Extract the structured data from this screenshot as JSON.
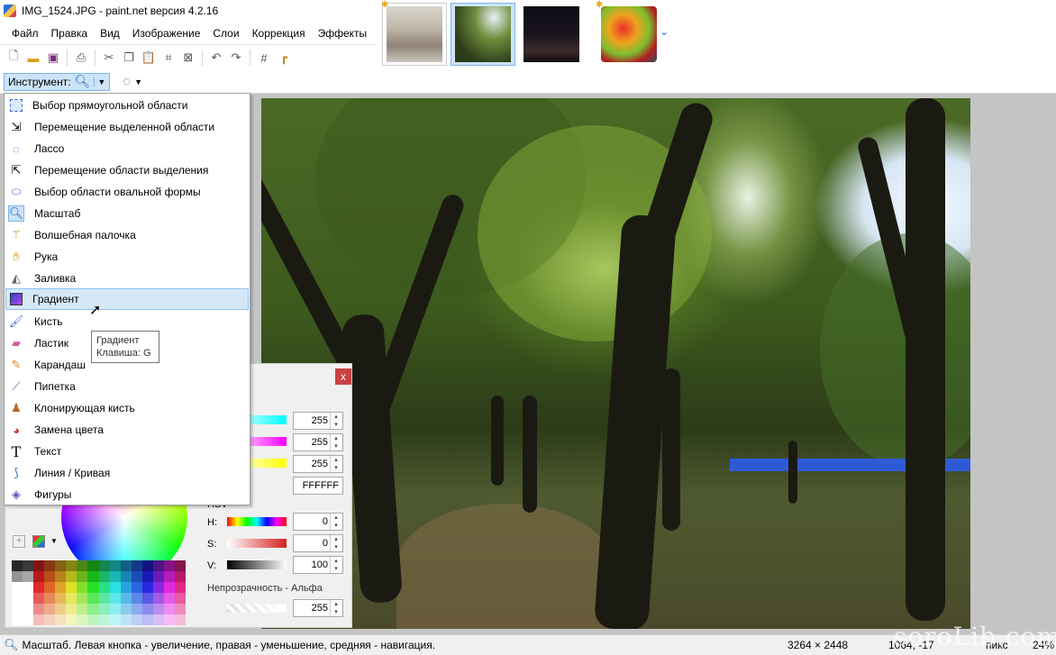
{
  "window": {
    "title": "IMG_1524.JPG - paint.net версия 4.2.16"
  },
  "menu": [
    "Файл",
    "Правка",
    "Вид",
    "Изображение",
    "Слои",
    "Коррекция",
    "Эффекты"
  ],
  "tool_options": {
    "tool_label": "Инструмент:"
  },
  "tool_menu": {
    "items": [
      {
        "label": "Выбор прямоугольной области",
        "icon": "rectangle-select-icon"
      },
      {
        "label": "Перемещение выделенной области",
        "icon": "move-selected-icon"
      },
      {
        "label": "Лассо",
        "icon": "lasso-icon"
      },
      {
        "label": "Перемещение области выделения",
        "icon": "move-selection-icon"
      },
      {
        "label": "Выбор области овальной формы",
        "icon": "ellipse-select-icon"
      },
      {
        "label": "Масштаб",
        "icon": "zoom-icon"
      },
      {
        "label": "Волшебная палочка",
        "icon": "magic-wand-icon"
      },
      {
        "label": "Рука",
        "icon": "hand-icon"
      },
      {
        "label": "Заливка",
        "icon": "paint-bucket-icon"
      },
      {
        "label": "Градиент",
        "icon": "gradient-icon"
      },
      {
        "label": "Кисть",
        "icon": "brush-icon"
      },
      {
        "label": "Ластик",
        "icon": "eraser-icon"
      },
      {
        "label": "Карандаш",
        "icon": "pencil-icon"
      },
      {
        "label": "Пипетка",
        "icon": "color-picker-icon"
      },
      {
        "label": "Клонирующая кисть",
        "icon": "clone-stamp-icon"
      },
      {
        "label": "Замена цвета",
        "icon": "recolor-icon"
      },
      {
        "label": "Текст",
        "icon": "text-icon"
      },
      {
        "label": "Линия / Кривая",
        "icon": "line-curve-icon"
      },
      {
        "label": "Фигуры",
        "icon": "shapes-icon"
      }
    ],
    "highlighted": "Градиент"
  },
  "tooltip": {
    "title": "Градиент",
    "shortcut": "Клавиша: G"
  },
  "colors_panel": {
    "close": "x",
    "rgb": {
      "r": "255",
      "g": "255",
      "b": "255"
    },
    "hex": "FFFFFF",
    "hsv_label": "HSV",
    "h_label": "H:",
    "h": "0",
    "s_label": "S:",
    "s": "0",
    "v_label": "V:",
    "v": "100",
    "alpha_label": "Непрозрачность - Альфа",
    "alpha": "255"
  },
  "statusbar": {
    "text": "Масштаб. Левая кнопка - увеличение, правая - уменьшение, средняя - навигация.",
    "dimensions": "3264 × 2448",
    "position": "1064, -17",
    "unit": "пикс",
    "zoom": "24%"
  },
  "watermark": "soroLib.com"
}
